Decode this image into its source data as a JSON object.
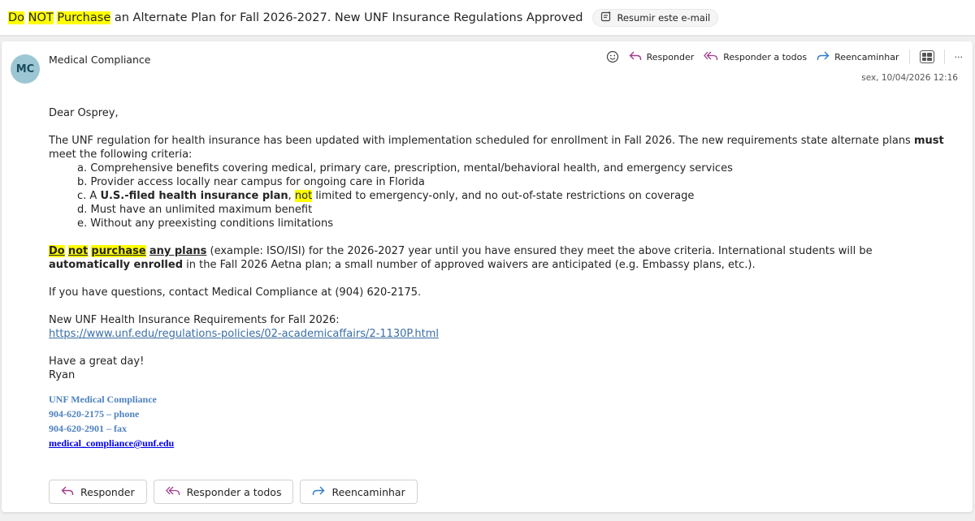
{
  "subject": {
    "part1": "Do",
    "part2": "NOT",
    "part3": "Purchase",
    "rest": "an Alternate Plan for Fall 2026-2027. New UNF Insurance Regulations Approved",
    "summarize_label": "Resumir este e-mail"
  },
  "message": {
    "avatar_initials": "MC",
    "sender": "Medical Compliance",
    "date": "sex, 10/04/2026 12:16",
    "reply_label": "Responder",
    "reply_all_label": "Responder a todos",
    "forward_label": "Reencaminhar",
    "more_label": "···"
  },
  "body": {
    "greeting": "Dear Osprey,",
    "p1_a": "The UNF regulation for health insurance has been updated with implementation scheduled for enrollment in Fall 2026. The new requirements state alternate plans ",
    "p1_b": "must",
    "p1_c": " meet the following criteria:",
    "list": {
      "a": "a. Comprehensive benefits covering medical, primary care, prescription, mental/behavioral health, and emergency services",
      "b": "b. Provider access locally near campus for ongoing care in Florida",
      "c_pre": "c. A ",
      "c_bold": "U.S.-filed health insurance plan",
      "c_mid": ", ",
      "c_hl": "not",
      "c_post": " limited to emergency-only, and no out-of-state restrictions on coverage",
      "d": "d. Must have an unlimited maximum benefit",
      "e": "e. Without any preexisting conditions limitations"
    },
    "p2_do": "Do",
    "p2_not": "not",
    "p2_purchase": "purchase",
    "p2_anyplans": "any plans",
    "p2_mid": " (example: ISO/ISI) for the 2026-2027 year until you have ensured they meet the above criteria. International students will be ",
    "p2_bold": "automatically enrolled",
    "p2_end": " in the Fall 2026 Aetna plan; a small number of approved waivers are anticipated (e.g. Embassy plans, etc.).",
    "p3": "If you have questions, contact Medical Compliance at (904) 620-2175.",
    "p4": "New UNF Health Insurance Requirements for Fall 2026:",
    "link": "https://www.unf.edu/regulations-policies/02-academicaffairs/2-1130P.html",
    "closing": "Have a great day!",
    "name": "Ryan"
  },
  "signature": {
    "org": "UNF Medical Compliance",
    "phone": "904-620-2175 – phone",
    "fax": "904-620-2901 – fax",
    "email": "medical_compliance@unf.edu"
  },
  "buttons": {
    "reply": "Responder",
    "reply_all": "Responder a todos",
    "forward": "Reencaminhar"
  }
}
